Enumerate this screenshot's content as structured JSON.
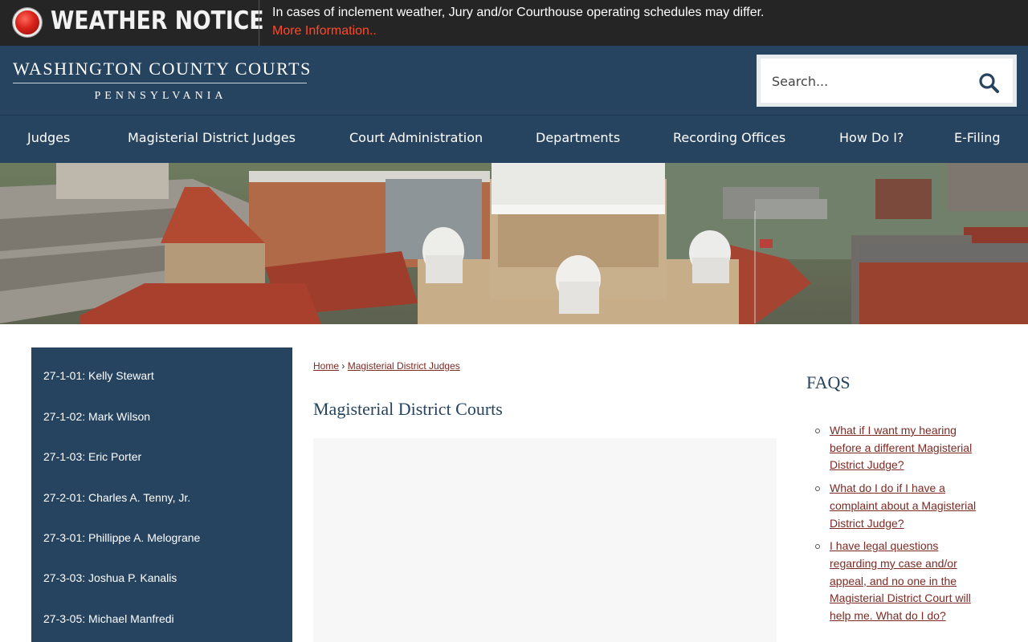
{
  "notice": {
    "title": "WEATHER NOTICE",
    "message": "In cases of inclement weather, Jury and/or Courthouse operating schedules may differ.",
    "link": "More Information.."
  },
  "header": {
    "logo_main": "WASHINGTON COUNTY COURTS",
    "logo_sub": "PENNSYLVANIA",
    "search_placeholder": "Search..."
  },
  "nav": {
    "items": [
      "Judges",
      "Magisterial District Judges",
      "Court Administration",
      "Departments",
      "Recording Offices",
      "How Do I?",
      "E-Filing"
    ]
  },
  "sidebar": {
    "items": [
      "27-1-01: Kelly Stewart",
      "27-1-02: Mark Wilson",
      "27-1-03: Eric Porter",
      "27-2-01: Charles A. Tenny, Jr.",
      "27-3-01: Phillippe A. Melograne",
      "27-3-03: Joshua P. Kanalis",
      "27-3-05: Michael Manfredi"
    ]
  },
  "breadcrumb": {
    "home": "Home",
    "separator": "›",
    "current": "Magisterial District Judges"
  },
  "main": {
    "title": "Magisterial District Courts"
  },
  "faqs": {
    "title": "FAQS",
    "items": [
      "What if I want my hearing before a different Magisterial District Judge?",
      "What do I do if I have a complaint about a Magisterial District Judge?",
      "I have legal questions regarding my case and/or appeal, and no one in the Magisterial District Court will help me. What do I do?"
    ]
  },
  "colors": {
    "navy": "#26435f",
    "notice_bg": "#252525",
    "link_red": "#7d2a25",
    "notice_link": "#ff4a2a"
  }
}
